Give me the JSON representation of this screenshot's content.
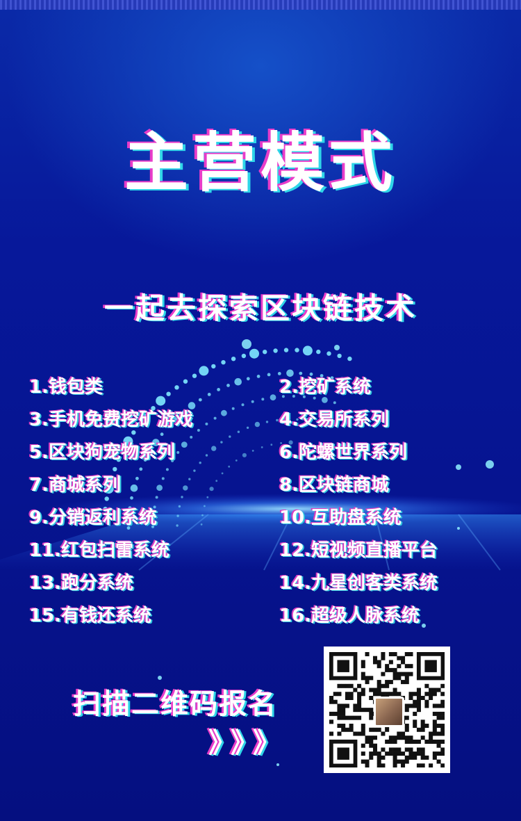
{
  "title": "主营模式",
  "subtitle": "一起去探索区块链技术",
  "features": [
    "1.钱包类",
    "2.挖矿系统",
    "3.手机免费挖矿游戏",
    "4.交易所系列",
    "5.区块狗宠物系列",
    "6.陀螺世界系列",
    "7.商城系列",
    "8.区块链商城",
    "9.分销返利系统",
    "10.互助盘系统",
    "11.红包扫雷系统",
    "12.短视频直播平台",
    "13.跑分系统",
    "14.九星创客类系统",
    "15.有钱还系统",
    "16.超级人脉系统"
  ],
  "cta": {
    "text": "扫描二维码报名",
    "chevrons": "》》》"
  },
  "colors": {
    "background": "#07189a",
    "glitch_magenta": "#e83cc9",
    "glitch_cyan": "#2fd6e8"
  }
}
